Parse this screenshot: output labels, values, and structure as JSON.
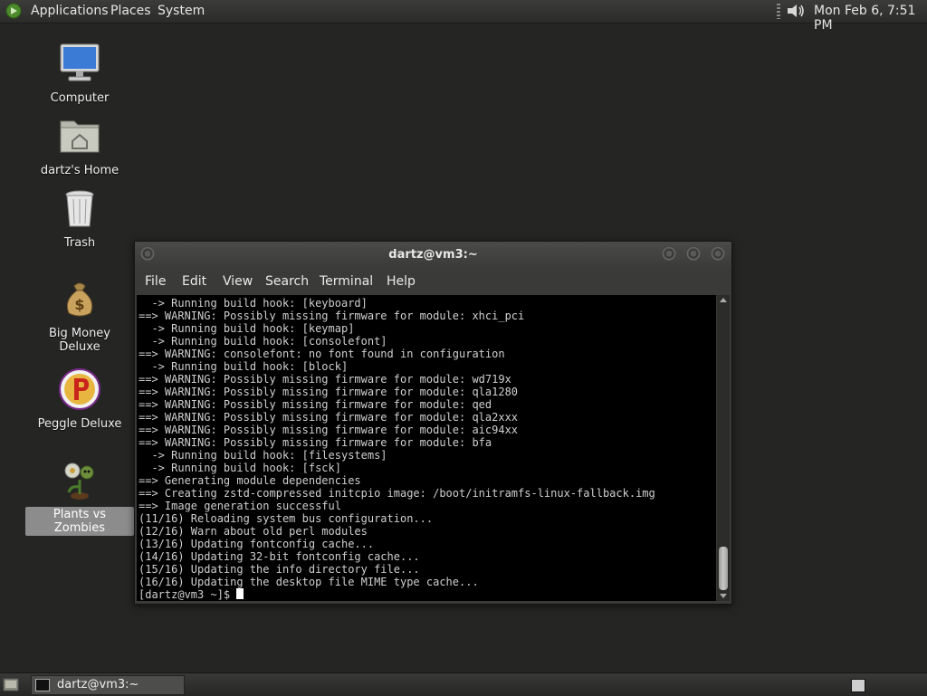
{
  "top_panel": {
    "menus": [
      "Applications",
      "Places",
      "System"
    ],
    "clock": "Mon Feb  6,  7:51 PM"
  },
  "desktop_icons": [
    {
      "label": "Computer",
      "icon": "computer-icon"
    },
    {
      "label": "dartz's Home",
      "icon": "home-folder-icon"
    },
    {
      "label": "Trash",
      "icon": "trash-icon"
    },
    {
      "label": "Big Money Deluxe",
      "icon": "money-bag-icon"
    },
    {
      "label": "Peggle Deluxe",
      "icon": "peggle-icon"
    },
    {
      "label": "Plants vs Zombies",
      "icon": "plant-icon",
      "selected": true
    }
  ],
  "terminal": {
    "title": "dartz@vm3:~",
    "menu": [
      "File",
      "Edit",
      "View",
      "Search",
      "Terminal",
      "Help"
    ],
    "lines": [
      "  -> Running build hook: [keyboard]",
      "==> WARNING: Possibly missing firmware for module: xhci_pci",
      "  -> Running build hook: [keymap]",
      "  -> Running build hook: [consolefont]",
      "==> WARNING: consolefont: no font found in configuration",
      "  -> Running build hook: [block]",
      "==> WARNING: Possibly missing firmware for module: wd719x",
      "==> WARNING: Possibly missing firmware for module: qla1280",
      "==> WARNING: Possibly missing firmware for module: qed",
      "==> WARNING: Possibly missing firmware for module: qla2xxx",
      "==> WARNING: Possibly missing firmware for module: aic94xx",
      "==> WARNING: Possibly missing firmware for module: bfa",
      "  -> Running build hook: [filesystems]",
      "  -> Running build hook: [fsck]",
      "==> Generating module dependencies",
      "==> Creating zstd-compressed initcpio image: /boot/initramfs-linux-fallback.img",
      "==> Image generation successful",
      "(11/16) Reloading system bus configuration...",
      "(12/16) Warn about old perl modules",
      "(13/16) Updating fontconfig cache...",
      "(14/16) Updating 32-bit fontconfig cache...",
      "(15/16) Updating the info directory file...",
      "(16/16) Updating the desktop file MIME type cache..."
    ],
    "prompt": "[dartz@vm3 ~]$ "
  },
  "taskbar": {
    "items": [
      {
        "label": "dartz@vm3:~",
        "icon": "terminal-icon"
      }
    ]
  },
  "colors": {
    "desktop_bg": "#252624",
    "panel_bg": "#2b2c2a",
    "terminal_bg": "#000000",
    "terminal_fg": "#cfcfcf",
    "selection": "#8c8c8c"
  }
}
